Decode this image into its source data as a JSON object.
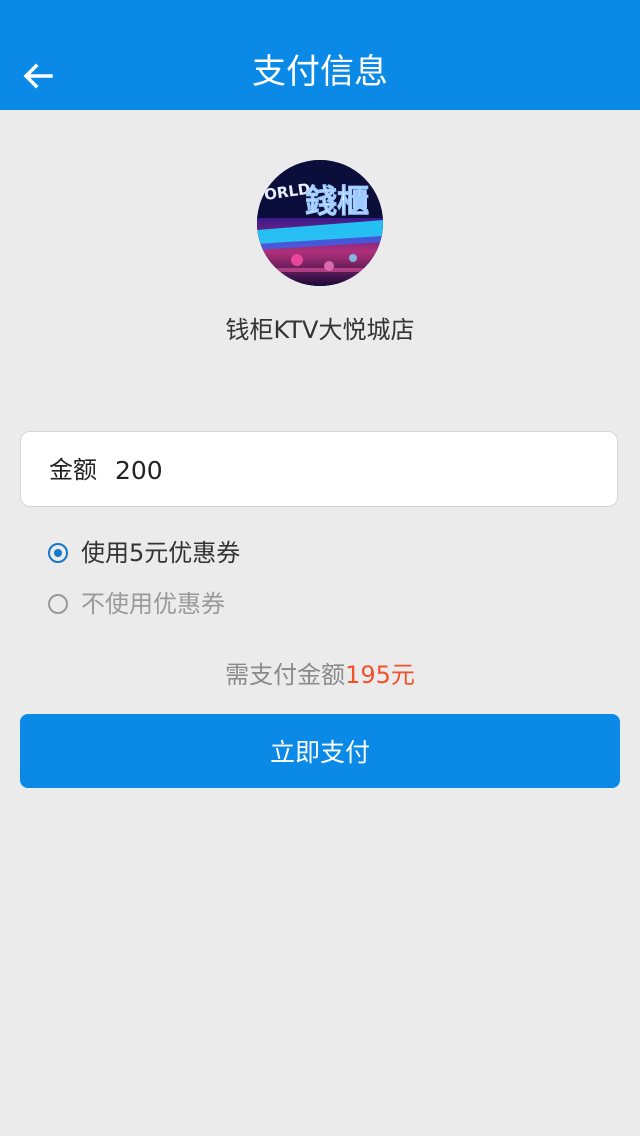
{
  "header": {
    "title": "支付信息",
    "back_icon": "arrow-left-icon",
    "color": "#0a8ae6"
  },
  "store": {
    "name": "钱柜KTV大悦城店",
    "avatar_sign_text": "錢櫃",
    "avatar_side_text": "ORLD"
  },
  "amount": {
    "label": "金额",
    "value": "200"
  },
  "coupon_options": [
    {
      "label": "使用5元优惠券",
      "selected": true
    },
    {
      "label": "不使用优惠券",
      "selected": false
    }
  ],
  "payment": {
    "total_prefix": "需支付金额",
    "total_amount": "195元",
    "accent_color": "#f0522a"
  },
  "pay_button": {
    "label": "立即支付"
  }
}
